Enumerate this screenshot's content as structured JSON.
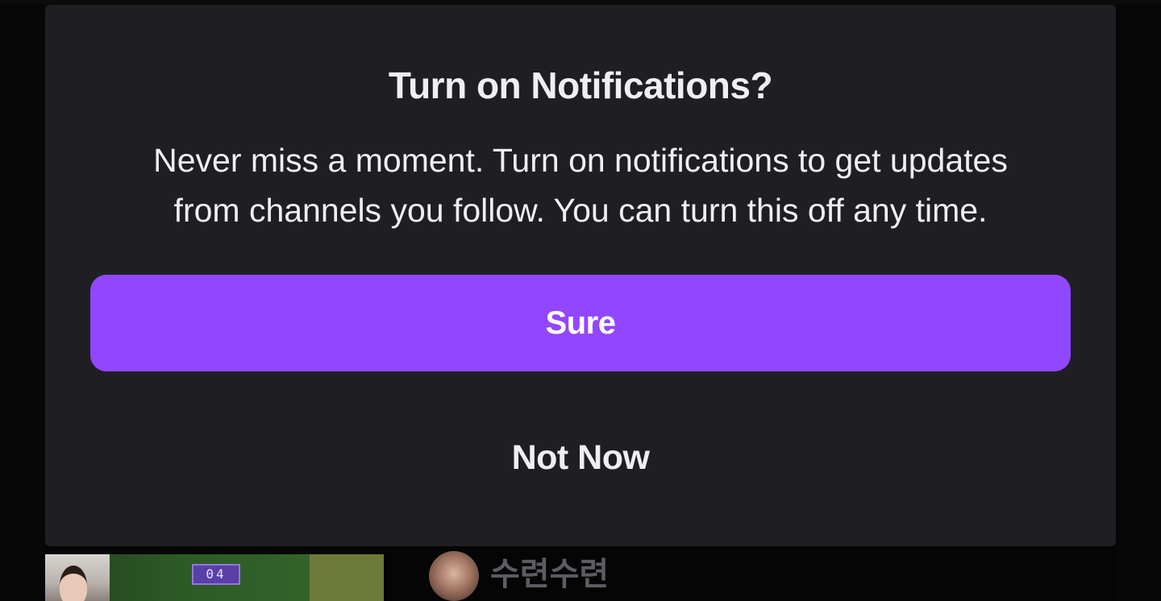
{
  "notification_dialog": {
    "title": "Turn on Notifications?",
    "message_line1": "Never miss a moment. Turn on notifications to get updates",
    "message_line2": "from channels you follow. You can turn this off any time.",
    "confirm_label": "Sure",
    "dismiss_label": "Not Now"
  },
  "background_feed": {
    "stream_score": "04",
    "channel_name": "수련수련"
  },
  "colors": {
    "dialog_bg": "#1f1f23",
    "accent": "#9147ff",
    "text": "#efeff1"
  }
}
